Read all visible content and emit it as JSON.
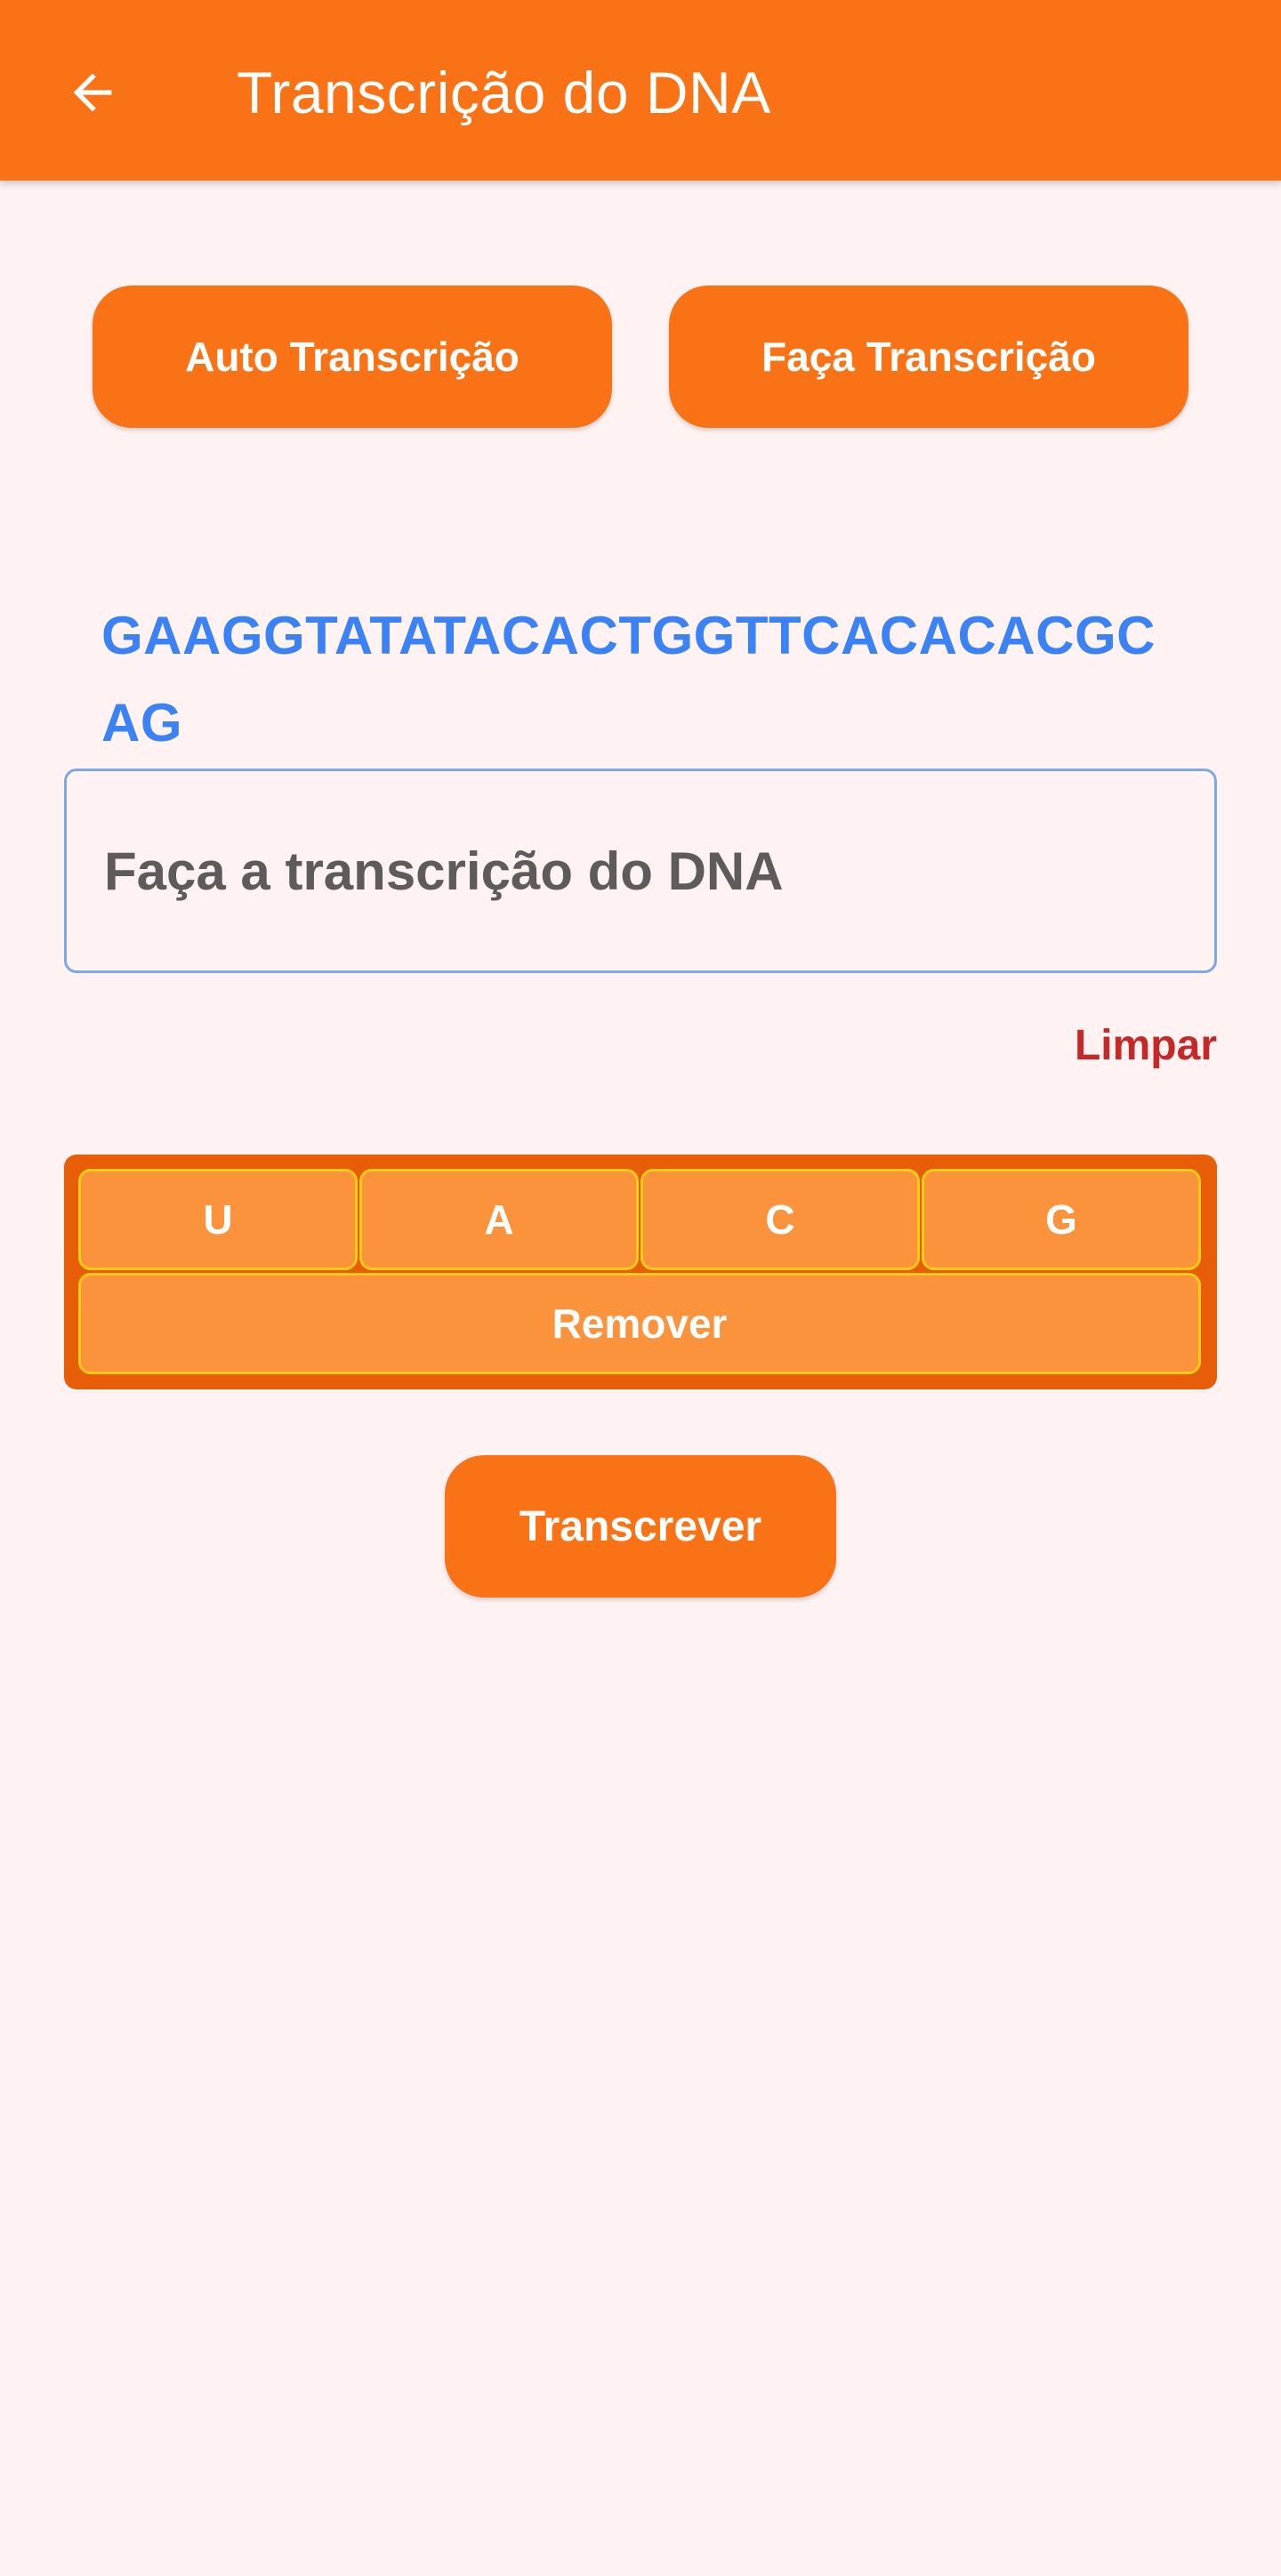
{
  "app_bar": {
    "title": "Transcrição do DNA",
    "back_icon": "arrow-left-icon",
    "background": "#F97316"
  },
  "mode_buttons": {
    "auto_label": "Auto Transcrição",
    "manual_label": "Faça Transcrição"
  },
  "dna": {
    "sequence": "GAAGGTATATACACTGGTTCACACACGCAG",
    "color": "#3B82F6"
  },
  "input": {
    "value": "",
    "placeholder": "Faça a transcrição do DNA"
  },
  "clear_label": "Limpar",
  "keyboard": {
    "keys": [
      "U",
      "A",
      "C",
      "G"
    ],
    "remove_label": "Remover"
  },
  "transcribe_label": "Transcrever",
  "colors": {
    "primary": "#F97316",
    "key_fill": "#FB923C",
    "key_border": "#FACC15",
    "keyboard_bg": "#E85D08",
    "background": "#FEF2F2",
    "clear": "#C62828"
  }
}
